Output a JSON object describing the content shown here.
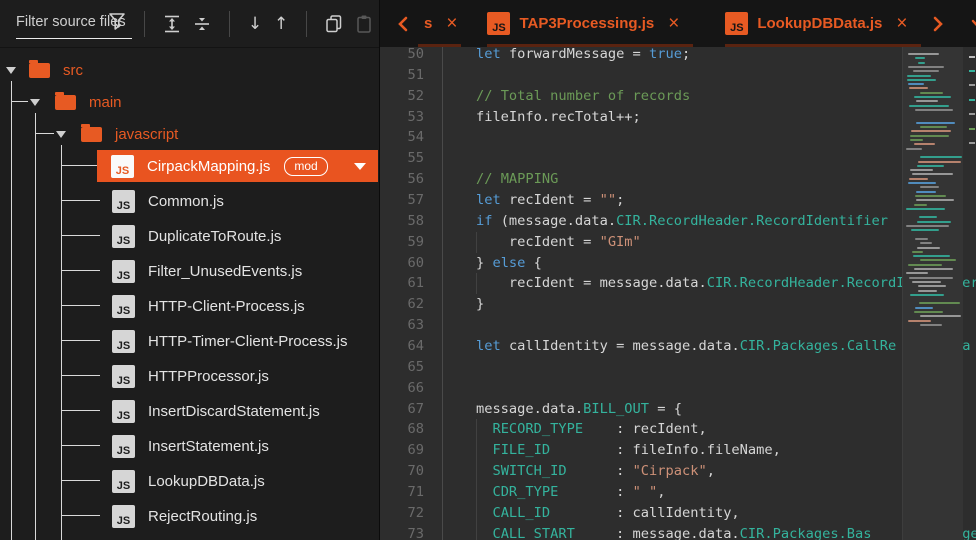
{
  "colors": {
    "accent": "#e75a23",
    "selection_bg": "#e95420",
    "tab_underline": "#5a2310",
    "editor_bg": "#2d2d2d",
    "panel_bg": "#1d1d1d",
    "tabbar_bg": "#151515",
    "keyword": "#569cd6",
    "type_teal": "#34b39d",
    "string": "#ce9178",
    "comment": "#6b9a57",
    "plain": "#d6d6d6"
  },
  "left_toolbar": {
    "filter_placeholder": "Filter source files",
    "icon_names": [
      "filter-icon",
      "expand-rows-icon",
      "collapse-rows-icon",
      "arrow-down-icon",
      "arrow-up-icon",
      "copy-icon",
      "paste-icon"
    ]
  },
  "tab_bar": {
    "overflow_left_tab_fragment": "s",
    "close_glyph": "×",
    "badge_text": "JS",
    "tabs": [
      {
        "label": "TAP3Processing.js"
      },
      {
        "label": "LookupDBData.js"
      }
    ]
  },
  "file_tree": {
    "folders": [
      {
        "name": "src",
        "depth": 0
      },
      {
        "name": "main",
        "depth": 1
      },
      {
        "name": "javascript",
        "depth": 2
      }
    ],
    "selected_file": {
      "name": "CirpackMapping.js",
      "badge": "mod",
      "icon": "JS"
    },
    "files": [
      "Common.js",
      "DuplicateToRoute.js",
      "Filter_UnusedEvents.js",
      "HTTP-Client-Process.js",
      "HTTP-Timer-Client-Process.js",
      "HTTPProcessor.js",
      "InsertDiscardStatement.js",
      "InsertStatement.js",
      "LookupDBData.js",
      "RejectRouting.js"
    ],
    "file_icon_text": "JS"
  },
  "editor": {
    "first_line_number": 50,
    "lines": [
      [
        [
          "p",
          "    "
        ],
        [
          "k",
          "let"
        ],
        [
          "p",
          " forwardMessage = "
        ],
        [
          "k",
          "true"
        ],
        [
          "p",
          ";"
        ]
      ],
      [],
      [
        [
          "p",
          "    "
        ],
        [
          "c",
          "// Total number of records"
        ]
      ],
      [
        [
          "p",
          "    fileInfo.recTotal++;"
        ]
      ],
      [],
      [],
      [
        [
          "p",
          "    "
        ],
        [
          "c",
          "// MAPPING"
        ]
      ],
      [
        [
          "p",
          "    "
        ],
        [
          "k",
          "let"
        ],
        [
          "p",
          " recIdent = "
        ],
        [
          "s",
          "\"\""
        ],
        [
          "p",
          ";"
        ]
      ],
      [
        [
          "p",
          "    "
        ],
        [
          "k",
          "if"
        ],
        [
          "p",
          " (message.data."
        ],
        [
          "t",
          "CIR.RecordHeader.RecordIdentifier"
        ],
        [
          "p",
          "        )"
        ]
      ],
      [
        [
          "p",
          "        recIdent = "
        ],
        [
          "s",
          "\"GIm\""
        ]
      ],
      [
        [
          "p",
          "    } "
        ],
        [
          "k",
          "else"
        ],
        [
          "p",
          " {"
        ]
      ],
      [
        [
          "p",
          "        recIdent = message.data."
        ],
        [
          "t",
          "CIR.RecordHeader.RecordIdentifier"
        ]
      ],
      [
        [
          "p",
          "    }"
        ]
      ],
      [],
      [
        [
          "p",
          "    "
        ],
        [
          "k",
          "let"
        ],
        [
          "p",
          " callIdentity = message.data."
        ],
        [
          "t",
          "CIR.Packages.CallRe"
        ],
        [
          "p",
          "       "
        ],
        [
          "t",
          "Pa"
        ]
      ],
      [],
      [],
      [
        [
          "p",
          "    message.data."
        ],
        [
          "t",
          "BILL_OUT"
        ],
        [
          "p",
          " = {"
        ]
      ],
      [
        [
          "p",
          "      "
        ],
        [
          "t",
          "RECORD_TYPE"
        ],
        [
          "p",
          "    : recIdent,"
        ]
      ],
      [
        [
          "p",
          "      "
        ],
        [
          "t",
          "FILE_ID"
        ],
        [
          "p",
          "        : fileInfo.fileName,"
        ]
      ],
      [
        [
          "p",
          "      "
        ],
        [
          "t",
          "SWITCH_ID"
        ],
        [
          "p",
          "      : "
        ],
        [
          "s",
          "\"Cirpack\""
        ],
        [
          "p",
          ","
        ]
      ],
      [
        [
          "p",
          "      "
        ],
        [
          "t",
          "CDR_TYPE"
        ],
        [
          "p",
          "       : "
        ],
        [
          "s",
          "\" \""
        ],
        [
          "p",
          ","
        ]
      ],
      [
        [
          "p",
          "      "
        ],
        [
          "t",
          "CALL_ID"
        ],
        [
          "p",
          "        : callIdentity,"
        ]
      ],
      [
        [
          "p",
          "      "
        ],
        [
          "t",
          "CALL_START"
        ],
        [
          "p",
          "     : message.data."
        ],
        [
          "t",
          "CIR.Packages.Bas"
        ],
        [
          "p",
          "           "
        ],
        [
          "t",
          "ge"
        ]
      ]
    ]
  }
}
